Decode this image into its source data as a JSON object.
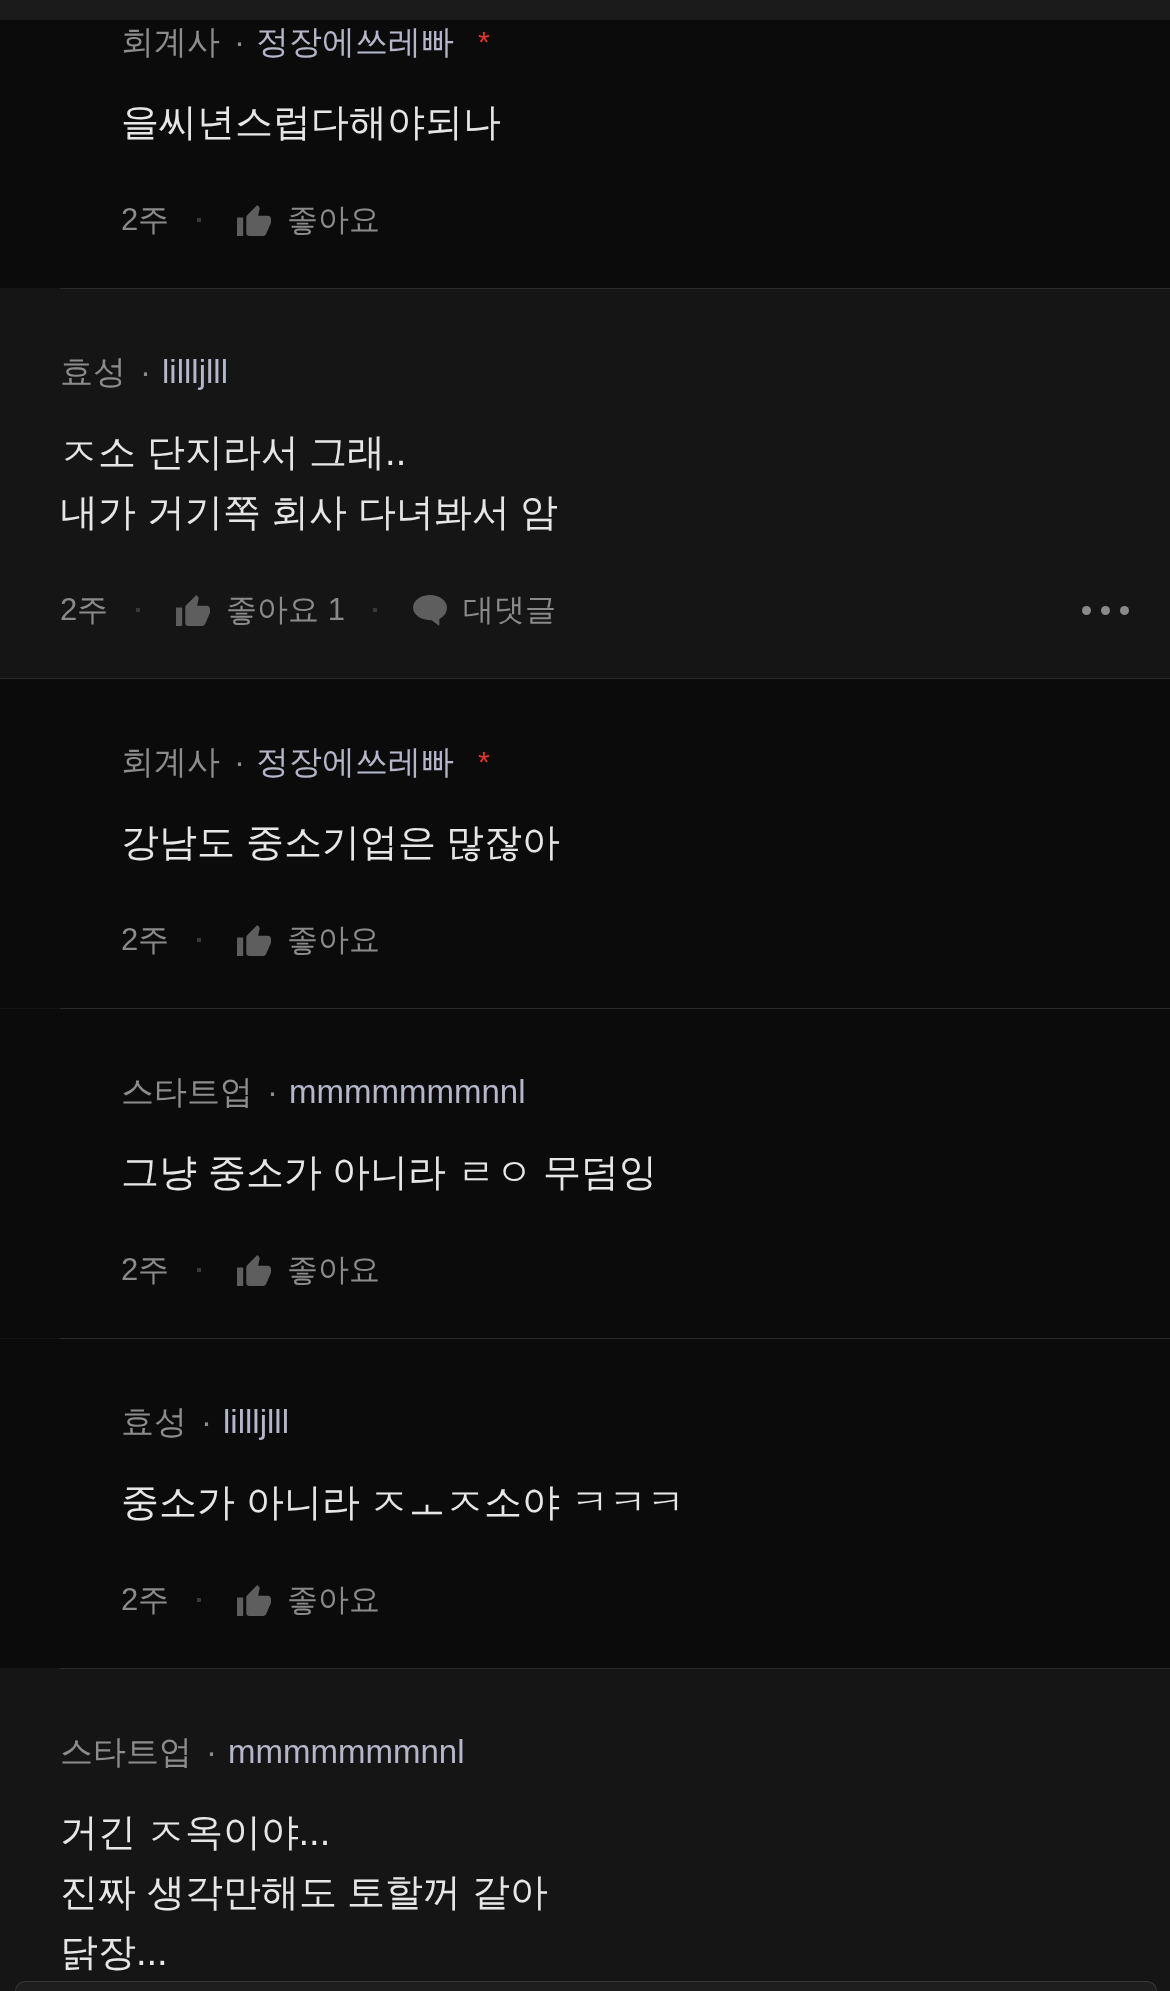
{
  "thread": [
    {
      "kind": "reply",
      "author": {
        "tag": "회계사",
        "separator": "·",
        "nickname": "정장에쓰레빠",
        "mark": "*"
      },
      "text": "을씨년스럽다해야되나",
      "footer": {
        "time": "2주",
        "like_label": "좋아요"
      }
    },
    {
      "kind": "comment",
      "author": {
        "tag": "효성",
        "separator": "·",
        "nickname": "lillljlll"
      },
      "text": "ㅈ소 단지라서 그래..\n내가 거기쪽 회사 다녀봐서 암",
      "footer": {
        "time": "2주",
        "like_label": "좋아요",
        "like_count": "1",
        "reply_label": "대댓글"
      },
      "children": [
        {
          "kind": "reply",
          "author": {
            "tag": "회계사",
            "separator": "·",
            "nickname": "정장에쓰레빠",
            "mark": "*"
          },
          "text": "강남도 중소기업은 많잖아",
          "footer": {
            "time": "2주",
            "like_label": "좋아요"
          }
        },
        {
          "kind": "reply",
          "author": {
            "tag": "스타트업",
            "separator": "·",
            "nickname": "mmmmmmmnnl"
          },
          "text": "그냥 중소가 아니라 ㄹㅇ 무덤잉",
          "footer": {
            "time": "2주",
            "like_label": "좋아요"
          }
        },
        {
          "kind": "reply",
          "author": {
            "tag": "효성",
            "separator": "·",
            "nickname": "lillljlll"
          },
          "text": "중소가 아니라 ㅈㅗㅈ소야 ㅋㅋㅋ",
          "footer": {
            "time": "2주",
            "like_label": "좋아요"
          }
        }
      ]
    },
    {
      "kind": "comment",
      "author": {
        "tag": "스타트업",
        "separator": "·",
        "nickname": "mmmmmmmnnl"
      },
      "text": "거긴 ㅈ옥이야...\n진짜 생각만해도 토할꺼 같아\n닭장..."
    }
  ]
}
